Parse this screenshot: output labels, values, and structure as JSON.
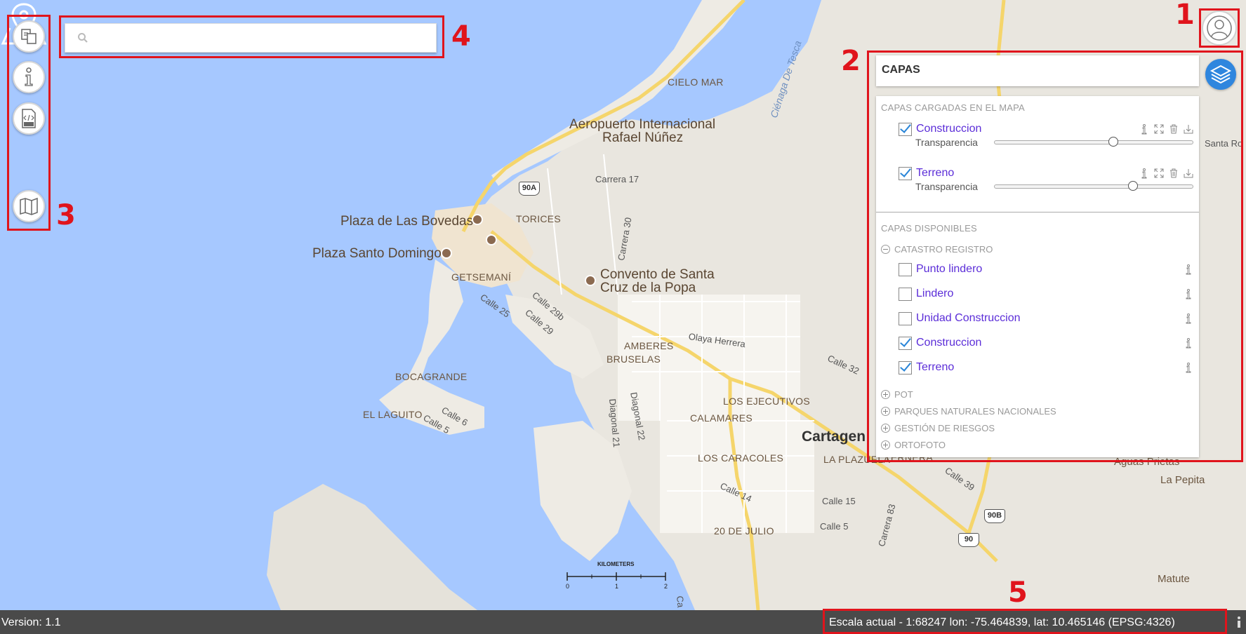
{
  "map": {
    "places": {
      "cielo_mar": "CIELO MAR",
      "aeropuerto": "Aeropuerto Internacional",
      "aeropuerto2": "Rafael Núñez",
      "carrera17": "Carrera 17",
      "plaza_bovedas": "Plaza de Las Bovedas",
      "torices": "TORICES",
      "plaza_santo_domingo": "Plaza Santo Domingo",
      "getsemani": "GETSEMANÍ",
      "convento": "Convento de Santa",
      "convento2": "Cruz de la Popa",
      "carrera30": "Carrera 30",
      "calle25": "Calle 25",
      "calle29b": "Calle 29b",
      "calle29": "Calle 29",
      "olaya": "Olaya Herrera",
      "amberes": "AMBERES",
      "bruselas": "BRUSELAS",
      "calle32": "Calle 32",
      "bocagrande": "BOCAGRANDE",
      "el_laguito": "EL LAGUITO",
      "calle6": "Calle 6",
      "calle5a": "Calle 5",
      "diagonal22": "Diagonal 22",
      "diagonal21": "Diagonal 21",
      "los_ejecutivos": "LOS EJECUTIVOS",
      "calamares": "CALAMARES",
      "cartagena": "Cartagen",
      "los_caracoles": "LOS CARACOLES",
      "la_plazuela": "LA PLAZUELA",
      "ternera": "TERNERA",
      "calle39": "Calle 39",
      "calle14": "Calle 14",
      "calle15": "Calle 15",
      "calle5b": "Calle 5",
      "carrera83": "Carrera 83",
      "veinte_julio": "20 DE JULIO",
      "aguas_prietas": "Aguas Prietas",
      "la_pepita": "La Pepita",
      "matute": "Matute",
      "santa_ro": "Santa Ro",
      "cienaga": "Ciénaga De Tesca",
      "ca": "Ca"
    },
    "shields": {
      "s90a": "90A",
      "s90b": "90B",
      "s90": "90"
    },
    "scale": {
      "label": "KILOMETERS",
      "t0": "0",
      "t1": "1",
      "t2": "2"
    }
  },
  "annotations": {
    "n1": "1",
    "n2": "2",
    "n3": "3",
    "n4": "4",
    "n5": "5"
  },
  "search": {
    "placeholder": "",
    "value": ""
  },
  "layers": {
    "title": "CAPAS",
    "loaded_title": "CAPAS CARGADAS EN EL MAPA",
    "transparency_label": "Transparencia",
    "loaded": [
      {
        "name": "Construccion",
        "checked": true,
        "opacity": 0.6
      },
      {
        "name": "Terreno",
        "checked": true,
        "opacity": 0.7
      }
    ],
    "available_title": "CAPAS DISPONIBLES",
    "groups": [
      {
        "name": "CATASTRO REGISTRO",
        "expanded": true
      },
      {
        "name": "POT",
        "expanded": false
      },
      {
        "name": "PARQUES NATURALES NACIONALES",
        "expanded": false
      },
      {
        "name": "GESTIÓN DE RIESGOS",
        "expanded": false
      },
      {
        "name": "ORTOFOTO",
        "expanded": false
      }
    ],
    "available": [
      {
        "name": "Punto lindero",
        "checked": false
      },
      {
        "name": "Lindero",
        "checked": false
      },
      {
        "name": "Unidad Construccion",
        "checked": false
      },
      {
        "name": "Construccion",
        "checked": true
      },
      {
        "name": "Terreno",
        "checked": true
      }
    ]
  },
  "status": {
    "version": "Version: 1.1",
    "coords": "Escala actual - 1:68247      lon: -75.464839, lat: 10.465146 (EPSG:4326)"
  },
  "colors": {
    "water": "#a6c8ff",
    "land": "#e9e6df",
    "accent": "#2f86de",
    "annotation": "#e0141c",
    "link": "#5b2dd8"
  }
}
